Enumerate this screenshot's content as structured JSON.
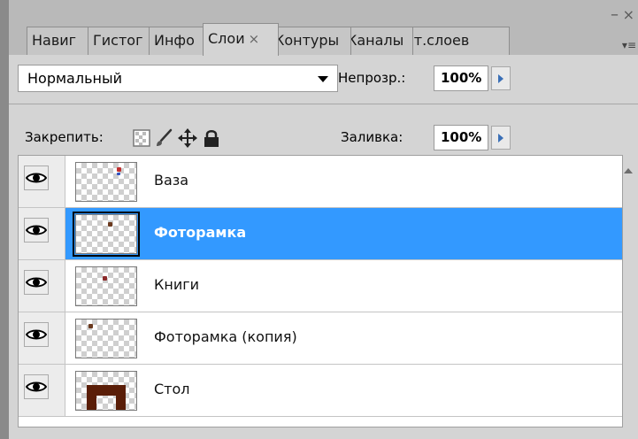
{
  "tabs": [
    {
      "label": "Навиг"
    },
    {
      "label": "Гистог"
    },
    {
      "label": "Инфо"
    },
    {
      "label": "Слои",
      "close": "×"
    },
    {
      "label": "Контуры"
    },
    {
      "label": "Каналы"
    },
    {
      "label": "Ист.слоев"
    }
  ],
  "blend": {
    "mode": "Нормальный",
    "opacity_label": "Непрозр.:",
    "opacity_value": "100%"
  },
  "lock": {
    "label": "Закрепить:",
    "fill_label": "Заливка:",
    "fill_value": "100%"
  },
  "layers": [
    {
      "name": "Ваза",
      "visible": true,
      "selected": false
    },
    {
      "name": "Фоторамка",
      "visible": true,
      "selected": true
    },
    {
      "name": "Книги",
      "visible": true,
      "selected": false
    },
    {
      "name": "Фоторамка (копия)",
      "visible": true,
      "selected": false
    },
    {
      "name": "Стол",
      "visible": true,
      "selected": false
    }
  ],
  "colors": {
    "selection": "#3399ff",
    "panel_bg": "#d4d4d4",
    "table_brown": "#5a1e08",
    "arrow_blue": "#3a6fb6"
  },
  "icons": [
    "eye-icon",
    "lock-transparent-icon",
    "lock-brush-icon",
    "lock-move-icon",
    "lock-all-icon",
    "dropdown-caret-icon",
    "stepper-arrow-icon",
    "panel-menu-icon"
  ]
}
